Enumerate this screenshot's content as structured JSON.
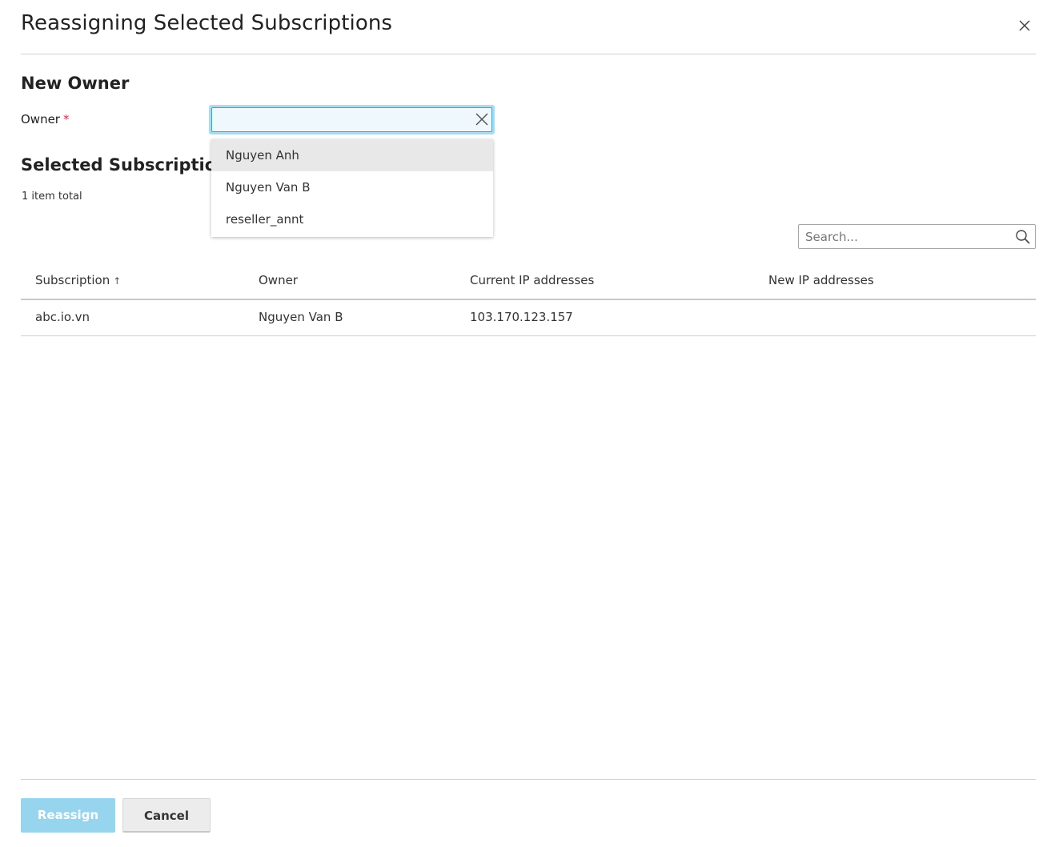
{
  "dialog": {
    "title": "Reassigning Selected Subscriptions"
  },
  "new_owner": {
    "heading": "New Owner",
    "owner_label": "Owner",
    "required_mark": "*",
    "owner_value": "",
    "dropdown_options": [
      "Nguyen Anh",
      "Nguyen Van B",
      "reseller_annt"
    ]
  },
  "selected_subscriptions": {
    "heading": "Selected Subscriptions",
    "item_total": "1 item total",
    "search_placeholder": "Search...",
    "columns": {
      "subscription": "Subscription",
      "sort_indicator": "↑",
      "owner": "Owner",
      "current_ip": "Current IP addresses",
      "new_ip": "New IP addresses"
    },
    "rows": [
      {
        "subscription": "abc.io.vn",
        "owner": "Nguyen Van B",
        "current_ip": "103.170.123.157",
        "new_ip": ""
      }
    ]
  },
  "footer": {
    "reassign_label": "Reassign",
    "cancel_label": "Cancel"
  },
  "colors": {
    "input_focus_border": "#28aade",
    "primary_button_disabled": "#97d4ee",
    "required_mark": "#d02c4e"
  },
  "icons": {
    "close": "close-icon",
    "clear": "clear-icon",
    "search": "search-icon"
  }
}
